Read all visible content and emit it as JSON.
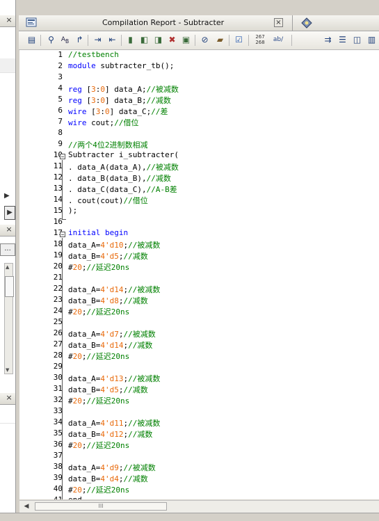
{
  "window": {
    "title": "Compilation Report - Subtracter",
    "close_label": "×"
  },
  "left_panel": {
    "close_labels": [
      "×",
      "×",
      "×"
    ],
    "ellipsis_button": "...",
    "arrow_right": "▶",
    "arrow_up": "▲",
    "arrow_down": "▼"
  },
  "toolbar": {
    "icons": [
      "report-icon",
      "find-icon",
      "replace-icon",
      "goto-icon",
      "indent-icon",
      "unindent-icon",
      "bookmark-icon",
      "bookmark-prev-icon",
      "bookmark-next-icon",
      "bookmark-clear-icon",
      "bookmark-all-icon",
      "insert-file-icon",
      "template-icon",
      "check-icon",
      "line-numbers-icon",
      "word-wrap-icon",
      "arrow-icon",
      "column-1-icon",
      "column-2-icon",
      "column-3-icon"
    ],
    "line_numbers_label_top": "267",
    "line_numbers_label_bottom": "268",
    "wrap_label": "ab/"
  },
  "editor": {
    "lines": [
      {
        "n": "1",
        "segs": [
          [
            "cm",
            "//testbench"
          ]
        ]
      },
      {
        "n": "2",
        "segs": [
          [
            "kw",
            "module"
          ],
          [
            "",
            "subtracter_tb();"
          ]
        ]
      },
      {
        "n": "3",
        "segs": []
      },
      {
        "n": "4",
        "segs": [
          [
            "kw",
            "reg"
          ],
          [
            "",
            " ["
          ],
          [
            "num",
            "3"
          ],
          [
            "",
            ":"
          ],
          [
            "num",
            "0"
          ],
          [
            "",
            "] data_A;"
          ],
          [
            "cm",
            "//被减数"
          ]
        ]
      },
      {
        "n": "5",
        "segs": [
          [
            "kw",
            "reg"
          ],
          [
            "",
            " ["
          ],
          [
            "num",
            "3"
          ],
          [
            "",
            ":"
          ],
          [
            "num",
            "0"
          ],
          [
            "",
            "] data_B;"
          ],
          [
            "cm",
            "//减数"
          ]
        ]
      },
      {
        "n": "6",
        "segs": [
          [
            "kw",
            "wire"
          ],
          [
            "",
            " ["
          ],
          [
            "num",
            "3"
          ],
          [
            "",
            ":"
          ],
          [
            "num",
            "0"
          ],
          [
            "",
            "] data_C;"
          ],
          [
            "cm",
            "//差"
          ]
        ]
      },
      {
        "n": "7",
        "segs": [
          [
            "kw",
            "wire"
          ],
          [
            "",
            " cout;"
          ],
          [
            "cm",
            "//借位"
          ]
        ]
      },
      {
        "n": "8",
        "segs": []
      },
      {
        "n": "9",
        "segs": [
          [
            "cm",
            "//两个4位2进制数相减"
          ]
        ]
      },
      {
        "n": "10",
        "segs": [
          [
            "",
            "Subtracter i_subtracter("
          ]
        ]
      },
      {
        "n": "11",
        "segs": [
          [
            "",
            ". data_A(data_A),"
          ],
          [
            "cm",
            "//被减数"
          ]
        ]
      },
      {
        "n": "12",
        "segs": [
          [
            "",
            ". data_B(data_B),"
          ],
          [
            "cm",
            "//减数"
          ]
        ]
      },
      {
        "n": "13",
        "segs": [
          [
            "",
            ". data_C(data_C),"
          ],
          [
            "cm",
            "//A-B差"
          ]
        ]
      },
      {
        "n": "14",
        "segs": [
          [
            "",
            ". cout(cout)"
          ],
          [
            "cm",
            "//借位"
          ]
        ]
      },
      {
        "n": "15",
        "segs": [
          [
            "",
            ");"
          ]
        ]
      },
      {
        "n": "16",
        "segs": []
      },
      {
        "n": "17",
        "segs": [
          [
            "kw",
            "initial begin"
          ]
        ]
      },
      {
        "n": "18",
        "segs": [
          [
            "",
            "data_A="
          ],
          [
            "num",
            "4'd10"
          ],
          [
            "",
            ";"
          ],
          [
            "cm",
            "//被减数"
          ]
        ]
      },
      {
        "n": "19",
        "segs": [
          [
            "",
            "data_B="
          ],
          [
            "num",
            "4'd5"
          ],
          [
            "",
            ";"
          ],
          [
            "cm",
            "//减数"
          ]
        ]
      },
      {
        "n": "20",
        "segs": [
          [
            "",
            "#"
          ],
          [
            "num",
            "20"
          ],
          [
            "",
            ";"
          ],
          [
            "cm",
            "//延迟20ns"
          ]
        ]
      },
      {
        "n": "21",
        "segs": []
      },
      {
        "n": "22",
        "segs": [
          [
            "",
            "data_A="
          ],
          [
            "num",
            "4'd14"
          ],
          [
            "",
            ";"
          ],
          [
            "cm",
            "//被减数"
          ]
        ]
      },
      {
        "n": "23",
        "segs": [
          [
            "",
            "data_B="
          ],
          [
            "num",
            "4'd8"
          ],
          [
            "",
            ";"
          ],
          [
            "cm",
            "//减数"
          ]
        ]
      },
      {
        "n": "24",
        "segs": [
          [
            "",
            "#"
          ],
          [
            "num",
            "20"
          ],
          [
            "",
            ";"
          ],
          [
            "cm",
            "//延迟20ns"
          ]
        ]
      },
      {
        "n": "25",
        "segs": []
      },
      {
        "n": "26",
        "segs": [
          [
            "",
            "data_A="
          ],
          [
            "num",
            "4'd7"
          ],
          [
            "",
            ";"
          ],
          [
            "cm",
            "//被减数"
          ]
        ]
      },
      {
        "n": "27",
        "segs": [
          [
            "",
            "data_B="
          ],
          [
            "num",
            "4'd14"
          ],
          [
            "",
            ";"
          ],
          [
            "cm",
            "//减数"
          ]
        ]
      },
      {
        "n": "28",
        "segs": [
          [
            "",
            "#"
          ],
          [
            "num",
            "20"
          ],
          [
            "",
            ";"
          ],
          [
            "cm",
            "//延迟20ns"
          ]
        ]
      },
      {
        "n": "29",
        "segs": []
      },
      {
        "n": "30",
        "segs": [
          [
            "",
            "data_A="
          ],
          [
            "num",
            "4'd13"
          ],
          [
            "",
            ";"
          ],
          [
            "cm",
            "//被减数"
          ]
        ]
      },
      {
        "n": "31",
        "segs": [
          [
            "",
            "data_B="
          ],
          [
            "num",
            "4'd5"
          ],
          [
            "",
            ";"
          ],
          [
            "cm",
            "//减数"
          ]
        ]
      },
      {
        "n": "32",
        "segs": [
          [
            "",
            "#"
          ],
          [
            "num",
            "20"
          ],
          [
            "",
            ";"
          ],
          [
            "cm",
            "//延迟20ns"
          ]
        ]
      },
      {
        "n": "33",
        "segs": []
      },
      {
        "n": "34",
        "segs": [
          [
            "",
            "data_A="
          ],
          [
            "num",
            "4'd11"
          ],
          [
            "",
            ";"
          ],
          [
            "cm",
            "//被减数"
          ]
        ]
      },
      {
        "n": "35",
        "segs": [
          [
            "",
            "data_B="
          ],
          [
            "num",
            "4'd12"
          ],
          [
            "",
            ";"
          ],
          [
            "cm",
            "//减数"
          ]
        ]
      },
      {
        "n": "36",
        "segs": [
          [
            "",
            "#"
          ],
          [
            "num",
            "20"
          ],
          [
            "",
            ";"
          ],
          [
            "cm",
            "//延迟20ns"
          ]
        ]
      },
      {
        "n": "37",
        "segs": []
      },
      {
        "n": "38",
        "segs": [
          [
            "",
            "data_A="
          ],
          [
            "num",
            "4'd9"
          ],
          [
            "",
            ";"
          ],
          [
            "cm",
            "//被减数"
          ]
        ]
      },
      {
        "n": "39",
        "segs": [
          [
            "",
            "data_B="
          ],
          [
            "num",
            "4'd4"
          ],
          [
            "",
            ";"
          ],
          [
            "cm",
            "//减数"
          ]
        ]
      },
      {
        "n": "40",
        "segs": [
          [
            "",
            "#"
          ],
          [
            "num",
            "20"
          ],
          [
            "",
            ";"
          ],
          [
            "cm",
            "//延迟20ns"
          ]
        ]
      },
      {
        "n": "41",
        "segs": [
          [
            "",
            "end"
          ]
        ]
      }
    ]
  },
  "scrollbar": {
    "left_arrow": "◀",
    "thumb_grip": "III"
  },
  "colors": {
    "keyword": "#0000ff",
    "comment": "#008000",
    "number": "#e8690a"
  }
}
